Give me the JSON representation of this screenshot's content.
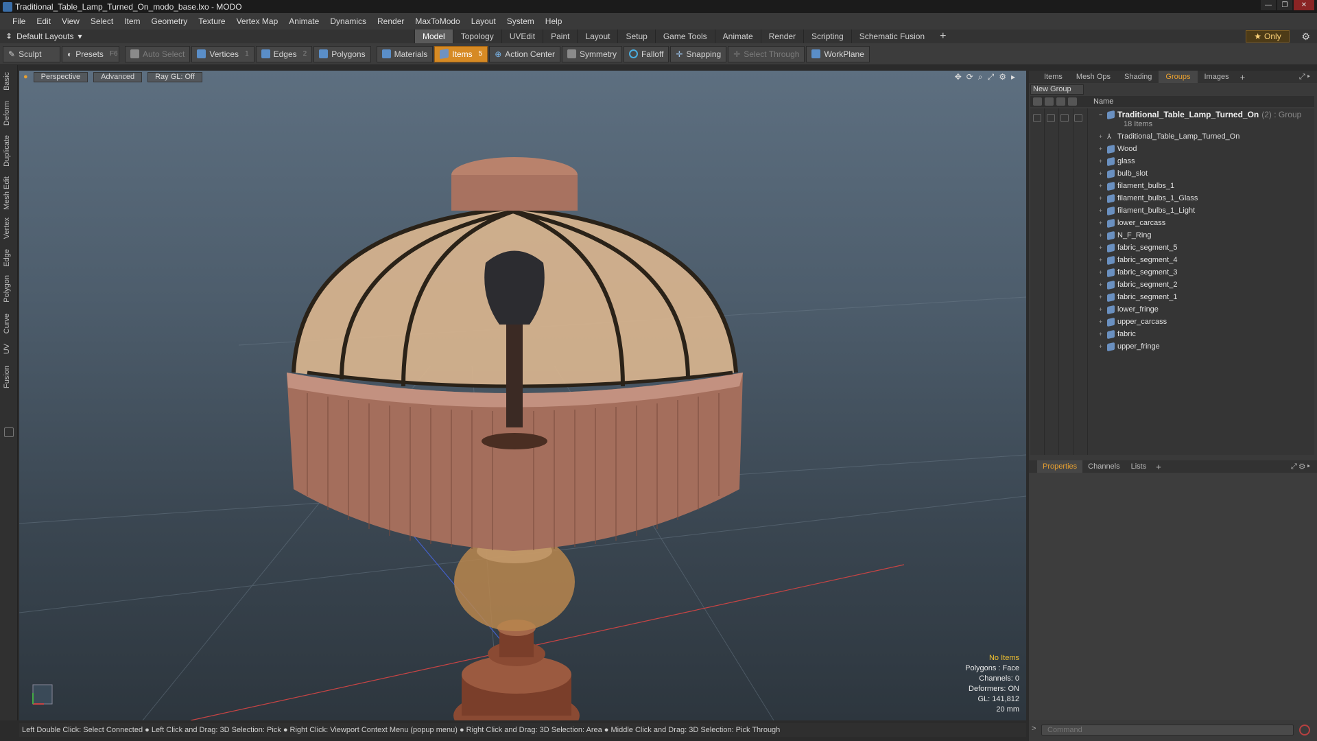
{
  "window": {
    "title": "Traditional_Table_Lamp_Turned_On_modo_base.lxo - MODO",
    "buttons": [
      "—",
      "❐",
      "✕"
    ]
  },
  "menu": [
    "File",
    "Edit",
    "View",
    "Select",
    "Item",
    "Geometry",
    "Texture",
    "Vertex Map",
    "Animate",
    "Dynamics",
    "Render",
    "MaxToModo",
    "Layout",
    "System",
    "Help"
  ],
  "layout": {
    "selector": "Default Layouts",
    "tabs": [
      "Model",
      "Topology",
      "UVEdit",
      "Paint",
      "Layout",
      "Setup",
      "Game Tools",
      "Animate",
      "Render",
      "Scripting",
      "Schematic Fusion"
    ],
    "active_tab": "Model",
    "add": "+",
    "only_label": "Only"
  },
  "toolbar": {
    "sculpt": "Sculpt",
    "presets": "Presets",
    "presets_key": "F6",
    "auto_select": "Auto Select",
    "vertices": "Vertices",
    "vertices_key": "1",
    "edges": "Edges",
    "edges_key": "2",
    "polygons": "Polygons",
    "materials": "Materials",
    "items": "Items",
    "items_key": "5",
    "action_center": "Action Center",
    "symmetry": "Symmetry",
    "falloff": "Falloff",
    "snapping": "Snapping",
    "select_through": "Select Through",
    "workplane": "WorkPlane"
  },
  "left_tabs": [
    "Basic",
    "Deform",
    "Duplicate",
    "Mesh Edit",
    "Vertex",
    "Edge",
    "Polygon",
    "Curve",
    "UV",
    "Fusion"
  ],
  "viewport": {
    "view_mode": "Perspective",
    "shading": "Advanced",
    "raygl": "Ray GL: Off",
    "stats": {
      "selection": "No Items",
      "polygons": "Polygons : Face",
      "channels": "Channels: 0",
      "deformers": "Deformers: ON",
      "gl": "GL: 141,812",
      "scale": "20 mm"
    }
  },
  "statusbar": "Left Double Click: Select Connected ● Left Click and Drag: 3D Selection: Pick ● Right Click: Viewport Context Menu (popup menu) ● Right Click and Drag: 3D Selection: Area ● Middle Click and Drag: 3D Selection: Pick Through",
  "right_panel": {
    "tabs": [
      "Items",
      "Mesh Ops",
      "Shading",
      "Groups",
      "Images"
    ],
    "active_tab": "Groups",
    "add": "+",
    "new_group": "New Group",
    "column_name": "Name",
    "group": {
      "name": "Traditional_Table_Lamp_Turned_On",
      "suffix": "(2) : Group",
      "count": "18 Items"
    },
    "items": [
      "Traditional_Table_Lamp_Turned_On",
      "Wood",
      "glass",
      "bulb_slot",
      "filament_bulbs_1",
      "filament_bulbs_1_Glass",
      "filament_bulbs_1_Light",
      "lower_carcass",
      "N_F_Ring",
      "fabric_segment_5",
      "fabric_segment_4",
      "fabric_segment_3",
      "fabric_segment_2",
      "fabric_segment_1",
      "lower_fringe",
      "upper_carcass",
      "fabric",
      "upper_fringe"
    ],
    "lower_tabs": [
      "Properties",
      "Channels",
      "Lists"
    ],
    "lower_active": "Properties",
    "command_placeholder": "Command"
  }
}
